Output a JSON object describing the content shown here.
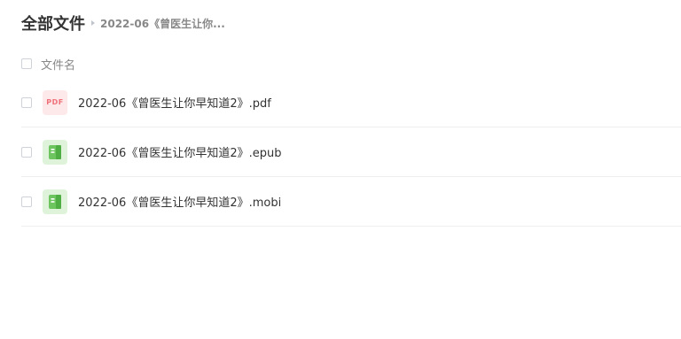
{
  "breadcrumb": {
    "root": "全部文件",
    "current": "2022-06《曾医生让你..."
  },
  "list_header": {
    "column_name": "文件名"
  },
  "files": [
    {
      "name": "2022-06《曾医生让你早知道2》.pdf",
      "icon": "pdf-file-icon",
      "icon_label": "PDF"
    },
    {
      "name": "2022-06《曾医生让你早知道2》.epub",
      "icon": "ebook-file-icon"
    },
    {
      "name": "2022-06《曾医生让你早知道2》.mobi",
      "icon": "ebook-file-icon"
    }
  ],
  "colors": {
    "pdf_icon_bg": "#fde8ea",
    "pdf_icon_fg": "#f0707a",
    "book_icon_bg": "#dff3da",
    "book_icon_fg": "#6cc55f"
  }
}
